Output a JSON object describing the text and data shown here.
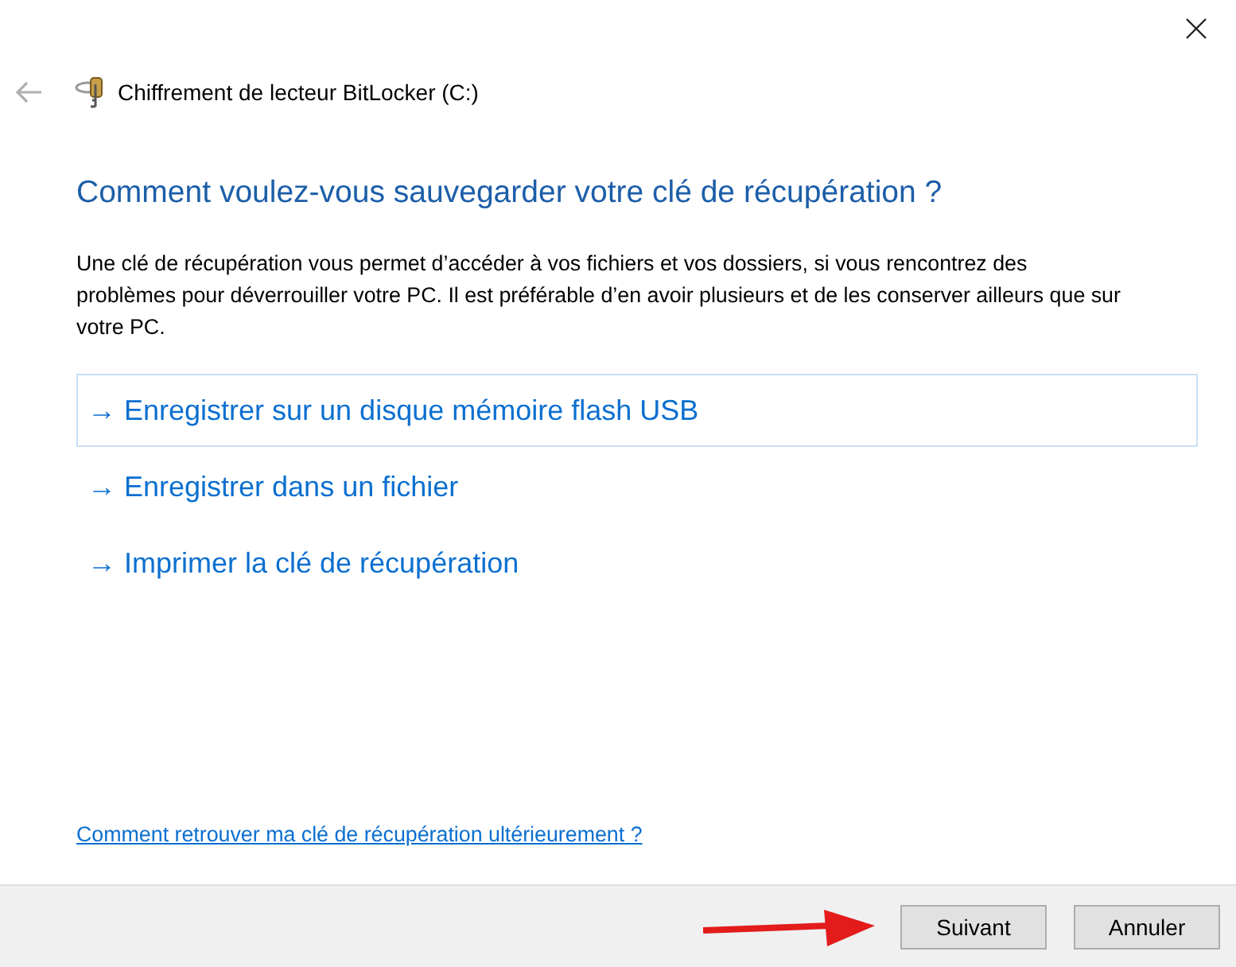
{
  "window": {
    "title": "Chiffrement de lecteur BitLocker (C:)",
    "back_disabled": true
  },
  "heading": "Comment voulez-vous sauvegarder votre clé de récupération ?",
  "description": "Une clé de récupération vous permet d’accéder à vos fichiers et vos dossiers, si vous rencontrez des problèmes pour déverrouiller votre PC. Il est préférable d’en avoir plusieurs et de les conserver ailleurs que sur votre PC.",
  "options": [
    {
      "label": "→ Enregistrer sur un disque mémoire flash USB",
      "selected": true
    },
    {
      "label": "→ Enregistrer dans un fichier",
      "selected": false
    },
    {
      "label": "→ Imprimer la clé de récupération",
      "selected": false
    }
  ],
  "help_link": "Comment retrouver ma clé de récupération ultérieurement ?",
  "buttons": [
    "Suivant",
    "Annuler"
  ]
}
